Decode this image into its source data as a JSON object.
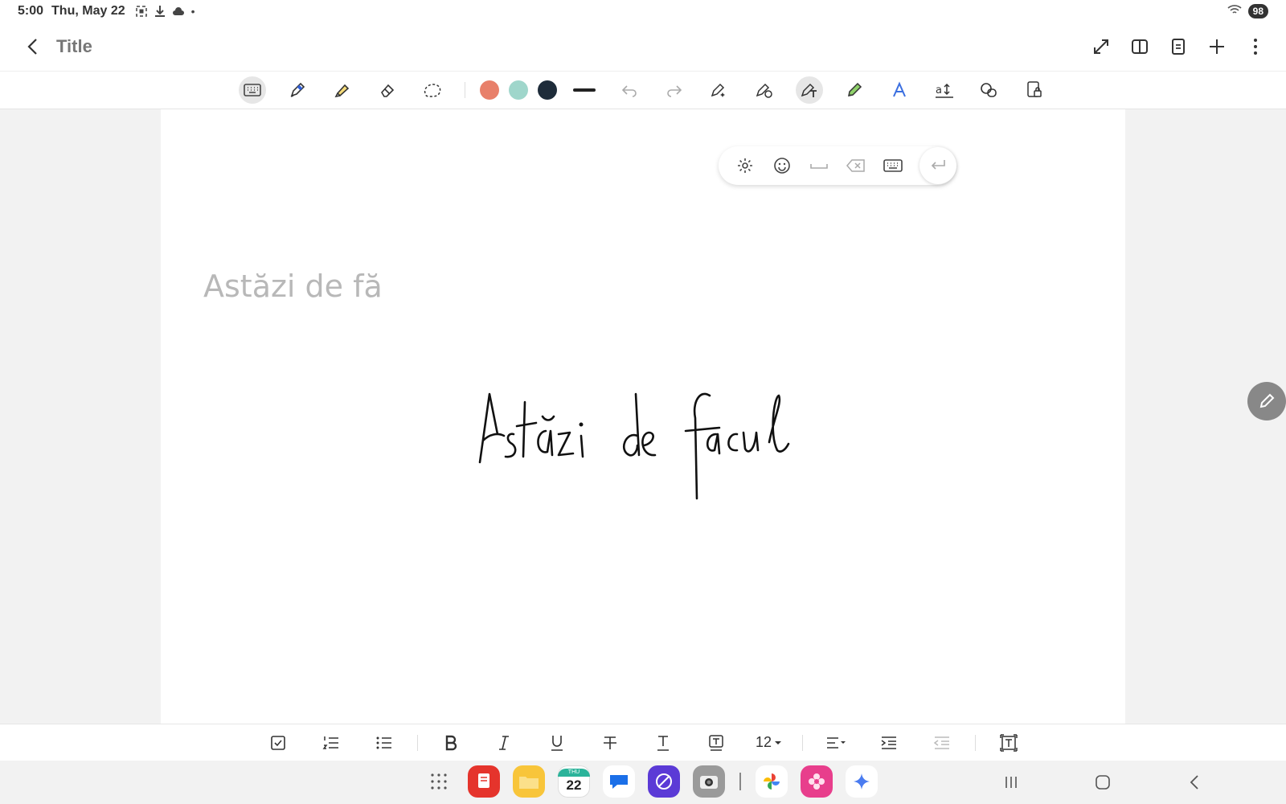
{
  "status_bar": {
    "time": "5:00",
    "date": "Thu, May 22",
    "icons": [
      "screenshot-icon",
      "download-icon",
      "cloud-icon",
      "dot-icon"
    ],
    "battery": "98"
  },
  "header": {
    "title": "Title",
    "actions": [
      "expand-icon",
      "book-view-icon",
      "page-icon",
      "add-icon",
      "more-icon"
    ]
  },
  "toolbar": {
    "tools": [
      "keyboard-icon",
      "pen-icon",
      "highlighter-icon",
      "eraser-icon",
      "lasso-icon"
    ],
    "colors": [
      "#e8806a",
      "#9fd6cb",
      "#1e2c3a"
    ],
    "history": [
      "undo-icon",
      "redo-icon"
    ],
    "modes": [
      "ai-pen-icon",
      "shape-pen-icon",
      "handwriting-to-text-icon",
      "pencil-icon",
      "text-style-icon",
      "text-resize-icon",
      "shapes-icon",
      "lock-page-icon"
    ]
  },
  "handwriting_toolbar": {
    "buttons": [
      "settings-icon",
      "emoji-icon",
      "space-icon",
      "backspace-icon",
      "keyboard-icon",
      "enter-icon"
    ]
  },
  "note": {
    "recognized_text": "Astăzi de fă",
    "handwriting": "Astăzi de facul"
  },
  "format_bar": {
    "font_size": "12",
    "buttons": [
      "checkbox-icon",
      "numbered-list-icon",
      "bullet-list-icon",
      "bold-icon",
      "italic-icon",
      "underline-icon",
      "strikethrough-icon",
      "text-color-icon",
      "text-background-icon",
      "font-size-select",
      "align-icon",
      "indent-icon",
      "outdent-icon",
      "text-box-icon"
    ]
  },
  "dock": {
    "calendar_day": "THU",
    "calendar_date": "22",
    "apps": [
      "app-drawer-icon",
      "notes-app-icon",
      "files-app-icon",
      "calendar-app-icon",
      "messages-app-icon",
      "internet-app-icon",
      "camera-app-icon",
      "photos-app-icon",
      "gallery-app-icon",
      "gemini-app-icon"
    ]
  }
}
